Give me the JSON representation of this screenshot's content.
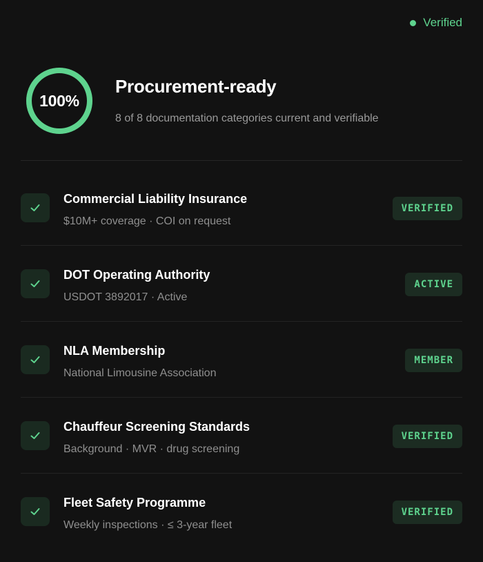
{
  "status": {
    "label": "Verified",
    "color": "#5ed38e"
  },
  "summary": {
    "percent_label": "100%",
    "progress": 1.0,
    "title": "Procurement-ready",
    "subtitle": "8 of 8 documentation categories current and verifiable"
  },
  "items": [
    {
      "title": "Commercial Liability Insurance",
      "subtitle": "$10M+ coverage · COI on request",
      "badge": "VERIFIED",
      "icon": "check-icon"
    },
    {
      "title": "DOT Operating Authority",
      "subtitle": "USDOT 3892017 · Active",
      "badge": "ACTIVE",
      "icon": "check-icon"
    },
    {
      "title": "NLA Membership",
      "subtitle": "National Limousine Association",
      "badge": "MEMBER",
      "icon": "check-icon"
    },
    {
      "title": "Chauffeur Screening Standards",
      "subtitle": "Background · MVR · drug screening",
      "badge": "VERIFIED",
      "icon": "check-icon"
    },
    {
      "title": "Fleet Safety Programme",
      "subtitle": "Weekly inspections · ≤ 3-year fleet",
      "badge": "VERIFIED",
      "icon": "check-icon"
    }
  ],
  "colors": {
    "accent": "#5ed38e",
    "background": "#121212",
    "badge_bg": "#1c2c22"
  }
}
